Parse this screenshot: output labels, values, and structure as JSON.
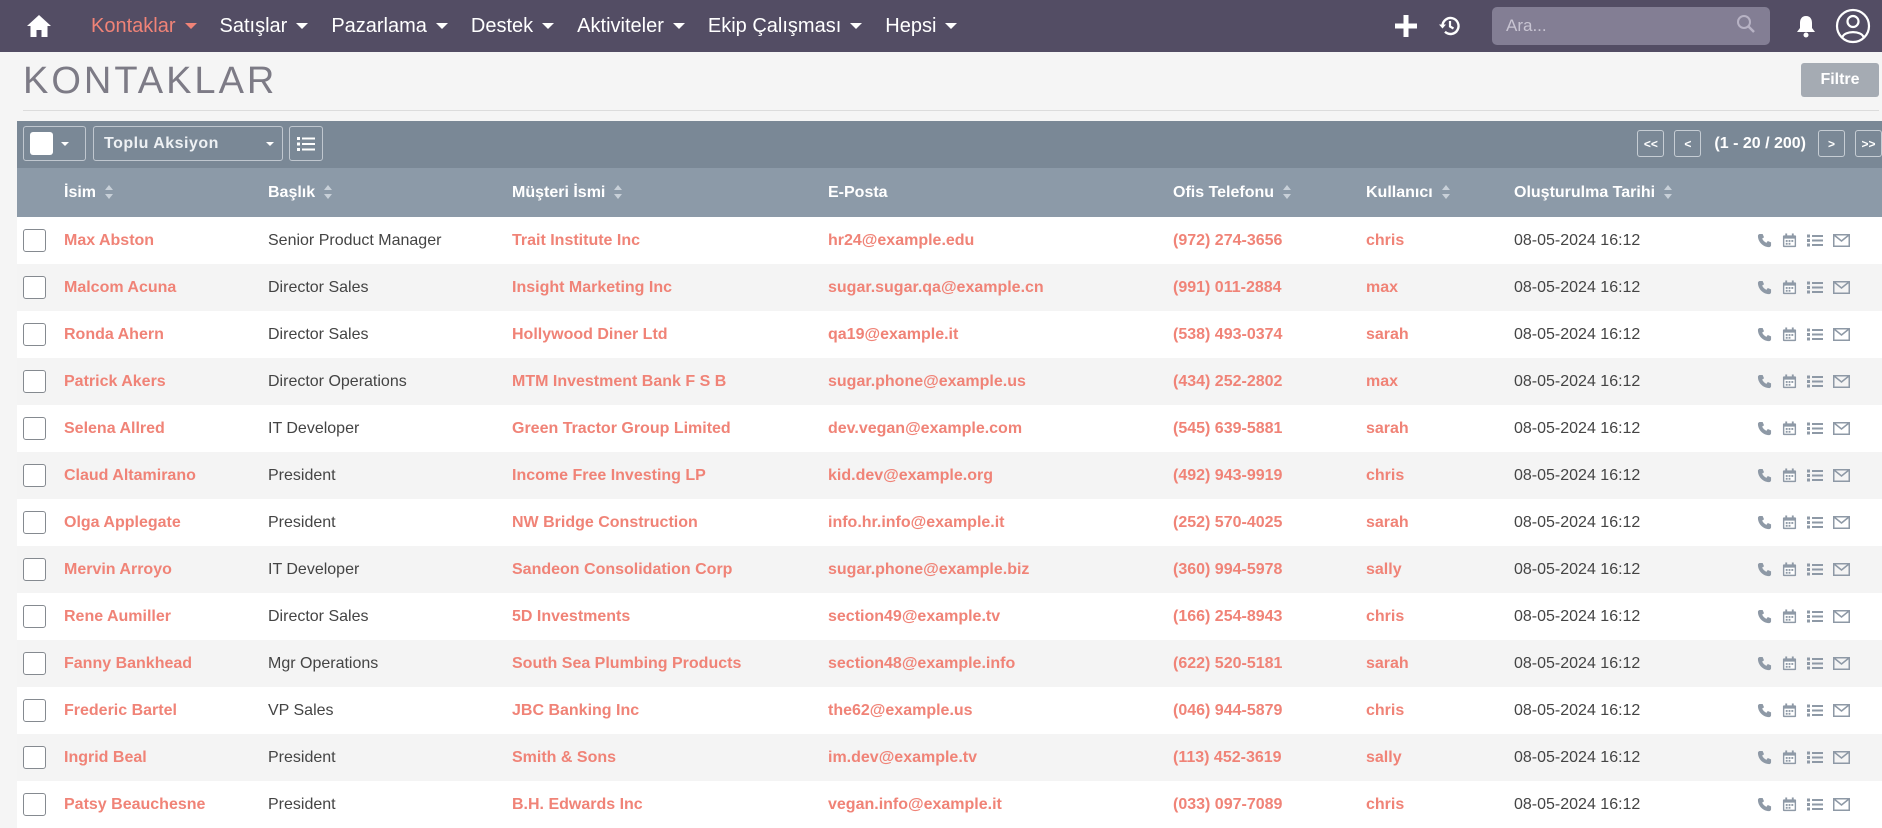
{
  "nav": {
    "items": [
      {
        "label": "Kontaklar",
        "active": true
      },
      {
        "label": "Satışlar",
        "active": false
      },
      {
        "label": "Pazarlama",
        "active": false
      },
      {
        "label": "Destek",
        "active": false
      },
      {
        "label": "Aktiviteler",
        "active": false
      },
      {
        "label": "Ekip Çalışması",
        "active": false
      },
      {
        "label": "Hepsi",
        "active": false
      }
    ],
    "search_placeholder": "Ara...",
    "icons": [
      "home-icon",
      "plus-icon",
      "history-icon",
      "search-icon",
      "bell-icon",
      "user-avatar-icon"
    ]
  },
  "header": {
    "title": "KONTAKLAR",
    "filter_label": "Filtre"
  },
  "toolbar": {
    "bulk_action_label": "Toplu Aksiyon",
    "pager": {
      "first": "<<",
      "prev": "<",
      "info": "(1 - 20 / 200)",
      "next": ">",
      "last": ">>"
    }
  },
  "table": {
    "columns": [
      "İsim",
      "Başlık",
      "Müşteri İsmi",
      "E-Posta",
      "Ofis Telefonu",
      "Kullanıcı",
      "Oluşturulma Tarihi"
    ],
    "rows": [
      {
        "name": "Max Abston",
        "title": "Senior Product Manager",
        "account": "Trait Institute Inc",
        "email": "hr24@example.edu",
        "phone": "(972) 274-3656",
        "user": "chris",
        "created": "08-05-2024 16:12"
      },
      {
        "name": "Malcom Acuna",
        "title": "Director Sales",
        "account": "Insight Marketing Inc",
        "email": "sugar.sugar.qa@example.cn",
        "phone": "(991) 011-2884",
        "user": "max",
        "created": "08-05-2024 16:12"
      },
      {
        "name": "Ronda Ahern",
        "title": "Director Sales",
        "account": "Hollywood Diner Ltd",
        "email": "qa19@example.it",
        "phone": "(538) 493-0374",
        "user": "sarah",
        "created": "08-05-2024 16:12"
      },
      {
        "name": "Patrick Akers",
        "title": "Director Operations",
        "account": "MTM Investment Bank F S B",
        "email": "sugar.phone@example.us",
        "phone": "(434) 252-2802",
        "user": "max",
        "created": "08-05-2024 16:12"
      },
      {
        "name": "Selena Allred",
        "title": "IT Developer",
        "account": "Green Tractor Group Limited",
        "email": "dev.vegan@example.com",
        "phone": "(545) 639-5881",
        "user": "sarah",
        "created": "08-05-2024 16:12"
      },
      {
        "name": "Claud Altamirano",
        "title": "President",
        "account": "Income Free Investing LP",
        "email": "kid.dev@example.org",
        "phone": "(492) 943-9919",
        "user": "chris",
        "created": "08-05-2024 16:12"
      },
      {
        "name": "Olga Applegate",
        "title": "President",
        "account": "NW Bridge Construction",
        "email": "info.hr.info@example.it",
        "phone": "(252) 570-4025",
        "user": "sarah",
        "created": "08-05-2024 16:12"
      },
      {
        "name": "Mervin Arroyo",
        "title": "IT Developer",
        "account": "Sandeon Consolidation Corp",
        "email": "sugar.phone@example.biz",
        "phone": "(360) 994-5978",
        "user": "sally",
        "created": "08-05-2024 16:12"
      },
      {
        "name": "Rene Aumiller",
        "title": "Director Sales",
        "account": "5D Investments",
        "email": "section49@example.tv",
        "phone": "(166) 254-8943",
        "user": "chris",
        "created": "08-05-2024 16:12"
      },
      {
        "name": "Fanny Bankhead",
        "title": "Mgr Operations",
        "account": "South Sea Plumbing Products",
        "email": "section48@example.info",
        "phone": "(622) 520-5181",
        "user": "sarah",
        "created": "08-05-2024 16:12"
      },
      {
        "name": "Frederic Bartel",
        "title": "VP Sales",
        "account": "JBC Banking Inc",
        "email": "the62@example.us",
        "phone": "(046) 944-5879",
        "user": "chris",
        "created": "08-05-2024 16:12"
      },
      {
        "name": "Ingrid Beal",
        "title": "President",
        "account": "Smith & Sons",
        "email": "im.dev@example.tv",
        "phone": "(113) 452-3619",
        "user": "sally",
        "created": "08-05-2024 16:12"
      },
      {
        "name": "Patsy Beauchesne",
        "title": "President",
        "account": "B.H. Edwards Inc",
        "email": "vegan.info@example.it",
        "phone": "(033) 097-7089",
        "user": "chris",
        "created": "08-05-2024 16:12"
      }
    ],
    "row_action_icons": [
      "phone-icon",
      "calendar-icon",
      "tasks-icon",
      "envelope-icon"
    ]
  },
  "colors": {
    "nav_bg": "#534d64",
    "accent": "#f08377",
    "toolbar_bg": "#7a8896",
    "header_bg": "#8c9aa8"
  }
}
